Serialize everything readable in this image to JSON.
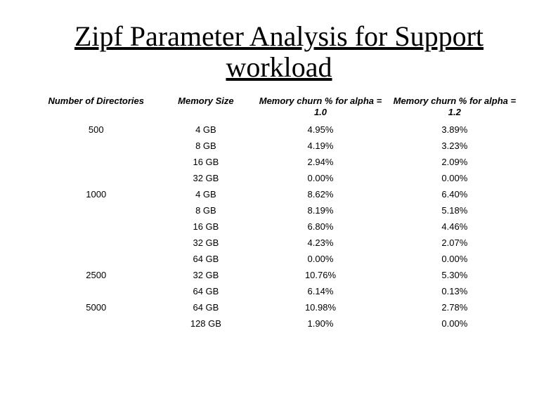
{
  "title": "Zipf Parameter Analysis for Support workload",
  "headers": {
    "h1": "Number of Directories",
    "h2": "Memory Size",
    "h3": "Memory churn % for alpha = 1.0",
    "h4": "Memory churn % for alpha = 1.2"
  },
  "rows": [
    {
      "dir": "500",
      "mem": "4 GB",
      "c1": "4.95%",
      "c2": "3.89%"
    },
    {
      "dir": "",
      "mem": "8 GB",
      "c1": "4.19%",
      "c2": "3.23%"
    },
    {
      "dir": "",
      "mem": "16 GB",
      "c1": "2.94%",
      "c2": "2.09%"
    },
    {
      "dir": "",
      "mem": "32 GB",
      "c1": "0.00%",
      "c2": "0.00%"
    },
    {
      "dir": "1000",
      "mem": "4 GB",
      "c1": "8.62%",
      "c2": "6.40%"
    },
    {
      "dir": "",
      "mem": "8 GB",
      "c1": "8.19%",
      "c2": "5.18%"
    },
    {
      "dir": "",
      "mem": "16 GB",
      "c1": "6.80%",
      "c2": "4.46%"
    },
    {
      "dir": "",
      "mem": "32 GB",
      "c1": "4.23%",
      "c2": "2.07%"
    },
    {
      "dir": "",
      "mem": "64 GB",
      "c1": "0.00%",
      "c2": "0.00%"
    },
    {
      "dir": "2500",
      "mem": "32 GB",
      "c1": "10.76%",
      "c2": "5.30%"
    },
    {
      "dir": "",
      "mem": "64 GB",
      "c1": "6.14%",
      "c2": "0.13%"
    },
    {
      "dir": "5000",
      "mem": "64 GB",
      "c1": "10.98%",
      "c2": "2.78%"
    },
    {
      "dir": "",
      "mem": "128 GB",
      "c1": "1.90%",
      "c2": "0.00%"
    }
  ],
  "chart_data": {
    "type": "table",
    "title": "Zipf Parameter Analysis for Support workload",
    "columns": [
      "Number of Directories",
      "Memory Size",
      "Memory churn % for alpha = 1.0",
      "Memory churn % for alpha = 1.2"
    ],
    "data": [
      [
        500,
        "4 GB",
        4.95,
        3.89
      ],
      [
        500,
        "8 GB",
        4.19,
        3.23
      ],
      [
        500,
        "16 GB",
        2.94,
        2.09
      ],
      [
        500,
        "32 GB",
        0.0,
        0.0
      ],
      [
        1000,
        "4 GB",
        8.62,
        6.4
      ],
      [
        1000,
        "8 GB",
        8.19,
        5.18
      ],
      [
        1000,
        "16 GB",
        6.8,
        4.46
      ],
      [
        1000,
        "32 GB",
        4.23,
        2.07
      ],
      [
        1000,
        "64 GB",
        0.0,
        0.0
      ],
      [
        2500,
        "32 GB",
        10.76,
        5.3
      ],
      [
        2500,
        "64 GB",
        6.14,
        0.13
      ],
      [
        5000,
        "64 GB",
        10.98,
        2.78
      ],
      [
        5000,
        "128 GB",
        1.9,
        0.0
      ]
    ]
  }
}
